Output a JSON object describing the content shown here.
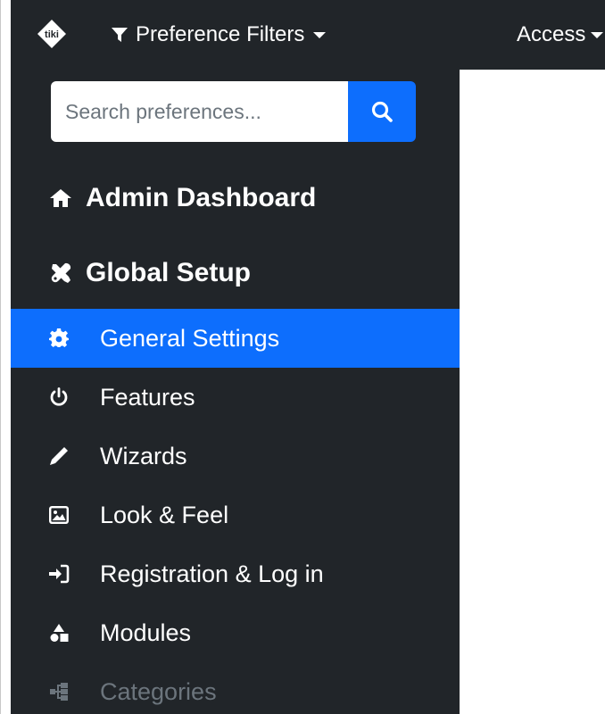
{
  "topbar": {
    "logo_text": "tiki",
    "filters_label": "Preference Filters",
    "access_label": "Access"
  },
  "search": {
    "placeholder": "Search preferences..."
  },
  "sections": [
    {
      "label": "Admin Dashboard",
      "icon": "home-icon"
    },
    {
      "label": "Global Setup",
      "icon": "tools-icon"
    }
  ],
  "items": [
    {
      "label": "General Settings",
      "icon": "cog-icon",
      "active": true
    },
    {
      "label": "Features",
      "icon": "power-icon"
    },
    {
      "label": "Wizards",
      "icon": "pen-icon"
    },
    {
      "label": "Look & Feel",
      "icon": "image-icon"
    },
    {
      "label": "Registration & Log in",
      "icon": "sign-in-icon"
    },
    {
      "label": "Modules",
      "icon": "shapes-icon"
    },
    {
      "label": "Categories",
      "icon": "sitemap-icon",
      "muted": true
    }
  ],
  "colors": {
    "topbar_bg": "#212529",
    "sidebar_bg": "#212529",
    "accent": "#0d6efd",
    "muted_text": "#6c757d"
  }
}
